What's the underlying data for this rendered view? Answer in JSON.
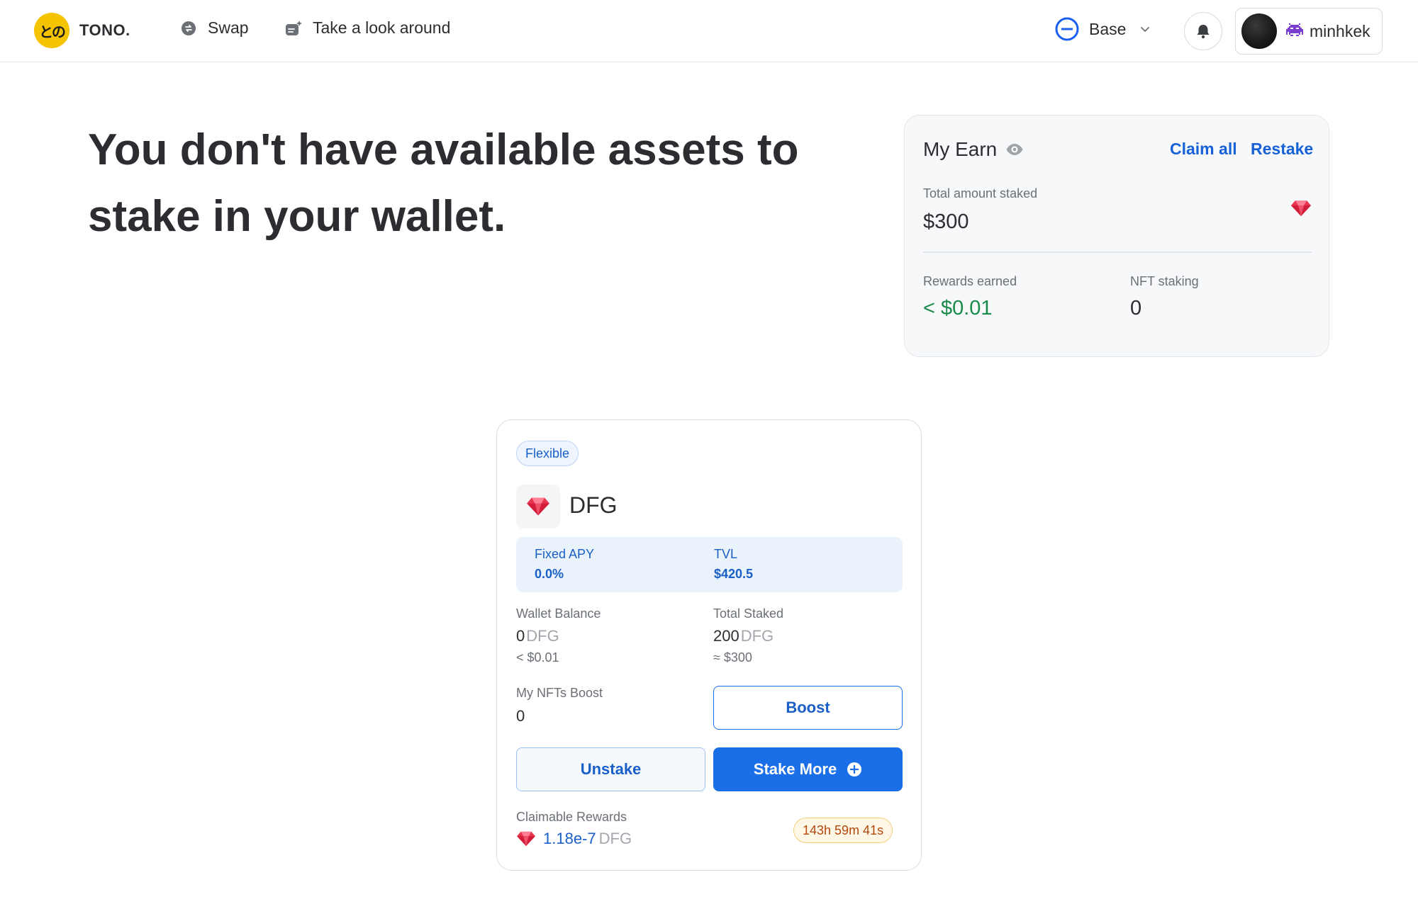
{
  "header": {
    "logo_badge": "との",
    "logo_text": "TONO.",
    "nav": {
      "swap_label": "Swap",
      "look_label": "Take a look around"
    },
    "network": {
      "label": "Base",
      "icon": "base-network-icon",
      "color": "#1b5ff0"
    },
    "user": {
      "emoji_icon": "alien-monster-icon",
      "name": "minhkek"
    }
  },
  "hero": {
    "title": "You don't have available assets to stake in your wallet."
  },
  "earn": {
    "title": "My Earn",
    "claim_all": "Claim all",
    "restake": "Restake",
    "total_staked_label": "Total amount staked",
    "total_staked_value": "$300",
    "rewards_label": "Rewards earned",
    "rewards_value": "< $0.01",
    "nft_label": "NFT staking",
    "nft_value": "0"
  },
  "pool": {
    "type_badge": "Flexible",
    "token": "DFG",
    "token_icon": "gem-icon",
    "apy_label": "Fixed APY",
    "apy_value": "0.0%",
    "tvl_label": "TVL",
    "tvl_value": "$420.5",
    "wallet_label": "Wallet Balance",
    "wallet_amount": "0",
    "wallet_unit": "DFG",
    "wallet_usd": "< $0.01",
    "staked_label": "Total Staked",
    "staked_amount": "200",
    "staked_unit": "DFG",
    "staked_usd": "≈ $300",
    "nft_boost_label": "My NFTs Boost",
    "nft_boost_value": "0",
    "boost_button": "Boost",
    "unstake_button": "Unstake",
    "stake_more_button": "Stake More",
    "claimable_label": "Claimable Rewards",
    "claimable_value": "1.18e-7",
    "claimable_unit": "DFG",
    "timer": "143h 59m 41s"
  },
  "colors": {
    "accent": "#1a6ee8",
    "positive": "#1a8a4a",
    "timer_text": "#b4470b",
    "logo_yellow": "#f5c400"
  }
}
